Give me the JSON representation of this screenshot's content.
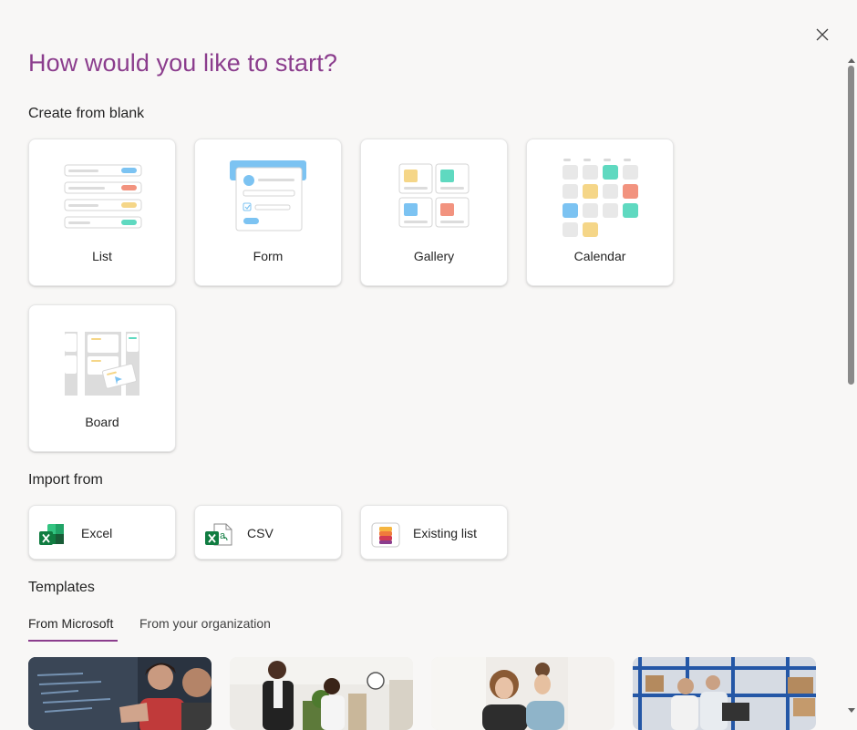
{
  "dialog": {
    "title": "How would you like to start?",
    "close_icon": "close-icon"
  },
  "create_blank": {
    "heading": "Create from blank",
    "cards": [
      {
        "label": "List",
        "icon": "list-illustration"
      },
      {
        "label": "Form",
        "icon": "form-illustration"
      },
      {
        "label": "Gallery",
        "icon": "gallery-illustration"
      },
      {
        "label": "Calendar",
        "icon": "calendar-illustration"
      },
      {
        "label": "Board",
        "icon": "board-illustration"
      }
    ]
  },
  "import_from": {
    "heading": "Import from",
    "items": [
      {
        "label": "Excel",
        "icon": "excel-icon"
      },
      {
        "label": "CSV",
        "icon": "csv-icon"
      },
      {
        "label": "Existing list",
        "icon": "existing-list-icon"
      }
    ]
  },
  "templates": {
    "heading": "Templates",
    "tabs": [
      {
        "label": "From Microsoft",
        "active": true
      },
      {
        "label": "From your organization",
        "active": false
      }
    ],
    "thumbnails": [
      "developer-photo",
      "office-meeting-photo",
      "colleagues-photo",
      "warehouse-photo"
    ]
  },
  "colors": {
    "accent": "#8b3d8d",
    "blue": "#7cc3f2",
    "red": "#f2937f",
    "yellow": "#f5d688",
    "teal": "#5fd9c0"
  }
}
